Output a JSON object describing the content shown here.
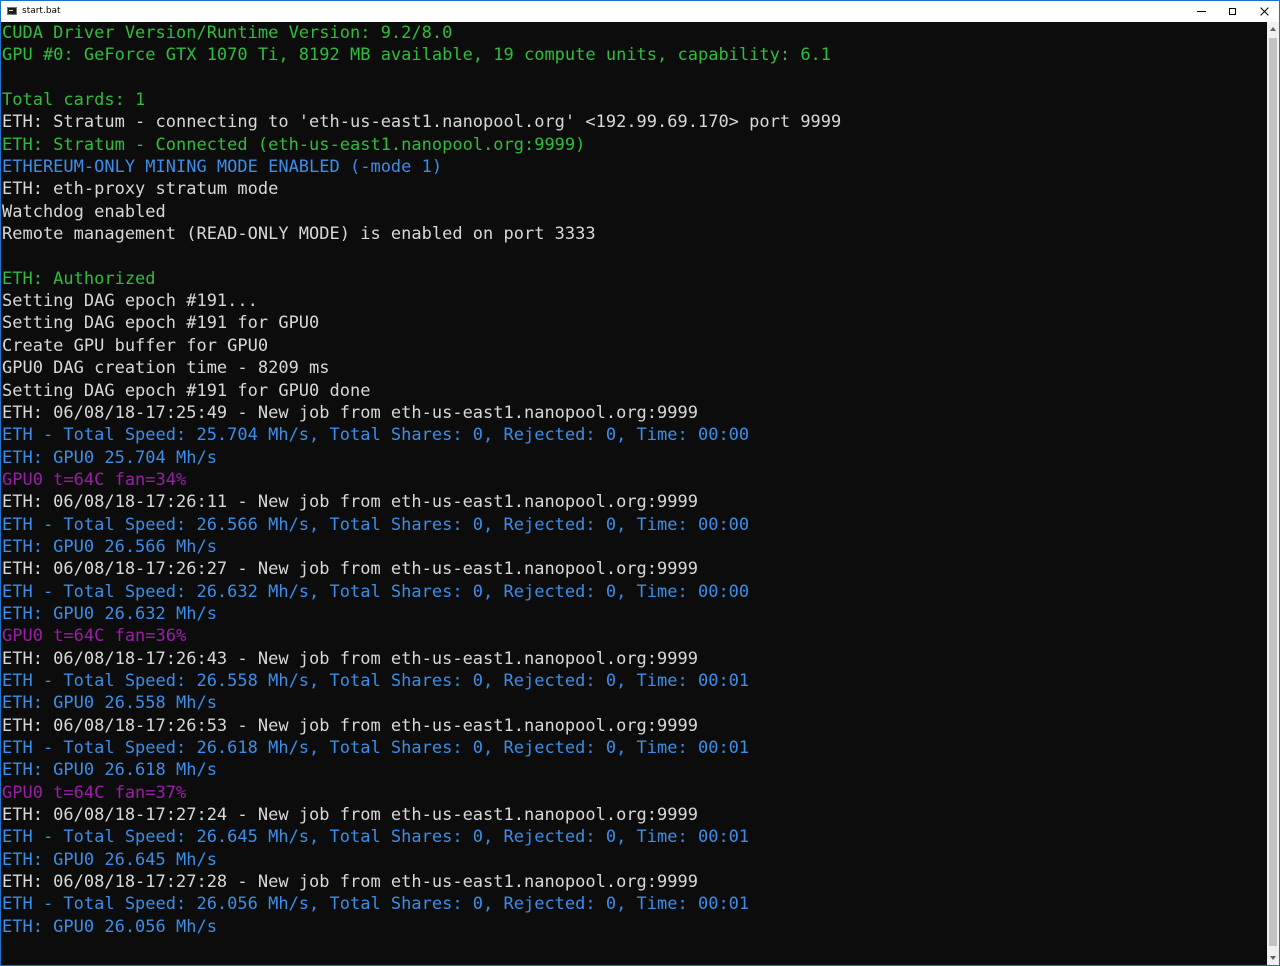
{
  "window": {
    "title": "start.bat",
    "icon": "console-icon",
    "controls": {
      "minimize": "minimize-icon",
      "maximize": "maximize-icon",
      "close": "close-icon"
    }
  },
  "colors": {
    "background": "#0c0c0c",
    "white": "#d8d8d8",
    "green": "#2fbd3c",
    "blue": "#3b8ee9",
    "magenta": "#9b1ea8"
  },
  "console": {
    "lines": [
      {
        "text": "CUDA Driver Version/Runtime Version: 9.2/8.0",
        "color": "green"
      },
      {
        "text": "GPU #0: GeForce GTX 1070 Ti, 8192 MB available, 19 compute units, capability: 6.1",
        "color": "green"
      },
      {
        "text": "",
        "color": "white"
      },
      {
        "text": "Total cards: 1",
        "color": "green"
      },
      {
        "text": "ETH: Stratum - connecting to 'eth-us-east1.nanopool.org' <192.99.69.170> port 9999",
        "color": "white"
      },
      {
        "text": "ETH: Stratum - Connected (eth-us-east1.nanopool.org:9999)",
        "color": "green"
      },
      {
        "text": "ETHEREUM-ONLY MINING MODE ENABLED (-mode 1)",
        "color": "blue"
      },
      {
        "text": "ETH: eth-proxy stratum mode",
        "color": "white"
      },
      {
        "text": "Watchdog enabled",
        "color": "white"
      },
      {
        "text": "Remote management (READ-ONLY MODE) is enabled on port 3333",
        "color": "white"
      },
      {
        "text": "",
        "color": "white"
      },
      {
        "text": "ETH: Authorized",
        "color": "green"
      },
      {
        "text": "Setting DAG epoch #191...",
        "color": "white"
      },
      {
        "text": "Setting DAG epoch #191 for GPU0",
        "color": "white"
      },
      {
        "text": "Create GPU buffer for GPU0",
        "color": "white"
      },
      {
        "text": "GPU0 DAG creation time - 8209 ms",
        "color": "white"
      },
      {
        "text": "Setting DAG epoch #191 for GPU0 done",
        "color": "white"
      },
      {
        "text": "ETH: 06/08/18-17:25:49 - New job from eth-us-east1.nanopool.org:9999",
        "color": "white"
      },
      {
        "text": "ETH - Total Speed: 25.704 Mh/s, Total Shares: 0, Rejected: 0, Time: 00:00",
        "color": "blue"
      },
      {
        "text": "ETH: GPU0 25.704 Mh/s",
        "color": "blue"
      },
      {
        "text": "GPU0 t=64C fan=34%",
        "color": "magenta"
      },
      {
        "text": "ETH: 06/08/18-17:26:11 - New job from eth-us-east1.nanopool.org:9999",
        "color": "white"
      },
      {
        "text": "ETH - Total Speed: 26.566 Mh/s, Total Shares: 0, Rejected: 0, Time: 00:00",
        "color": "blue"
      },
      {
        "text": "ETH: GPU0 26.566 Mh/s",
        "color": "blue"
      },
      {
        "text": "ETH: 06/08/18-17:26:27 - New job from eth-us-east1.nanopool.org:9999",
        "color": "white"
      },
      {
        "text": "ETH - Total Speed: 26.632 Mh/s, Total Shares: 0, Rejected: 0, Time: 00:00",
        "color": "blue"
      },
      {
        "text": "ETH: GPU0 26.632 Mh/s",
        "color": "blue"
      },
      {
        "text": "GPU0 t=64C fan=36%",
        "color": "magenta"
      },
      {
        "text": "ETH: 06/08/18-17:26:43 - New job from eth-us-east1.nanopool.org:9999",
        "color": "white"
      },
      {
        "text": "ETH - Total Speed: 26.558 Mh/s, Total Shares: 0, Rejected: 0, Time: 00:01",
        "color": "blue"
      },
      {
        "text": "ETH: GPU0 26.558 Mh/s",
        "color": "blue"
      },
      {
        "text": "ETH: 06/08/18-17:26:53 - New job from eth-us-east1.nanopool.org:9999",
        "color": "white"
      },
      {
        "text": "ETH - Total Speed: 26.618 Mh/s, Total Shares: 0, Rejected: 0, Time: 00:01",
        "color": "blue"
      },
      {
        "text": "ETH: GPU0 26.618 Mh/s",
        "color": "blue"
      },
      {
        "text": "GPU0 t=64C fan=37%",
        "color": "magenta"
      },
      {
        "text": "ETH: 06/08/18-17:27:24 - New job from eth-us-east1.nanopool.org:9999",
        "color": "white"
      },
      {
        "text": "ETH - Total Speed: 26.645 Mh/s, Total Shares: 0, Rejected: 0, Time: 00:01",
        "color": "blue"
      },
      {
        "text": "ETH: GPU0 26.645 Mh/s",
        "color": "blue"
      },
      {
        "text": "ETH: 06/08/18-17:27:28 - New job from eth-us-east1.nanopool.org:9999",
        "color": "white"
      },
      {
        "text": "ETH - Total Speed: 26.056 Mh/s, Total Shares: 0, Rejected: 0, Time: 00:01",
        "color": "blue"
      },
      {
        "text": "ETH: GPU0 26.056 Mh/s",
        "color": "blue"
      }
    ]
  },
  "scrollbar": {
    "up_icon": "scroll-up-arrow-icon",
    "down_icon": "scroll-down-arrow-icon"
  }
}
